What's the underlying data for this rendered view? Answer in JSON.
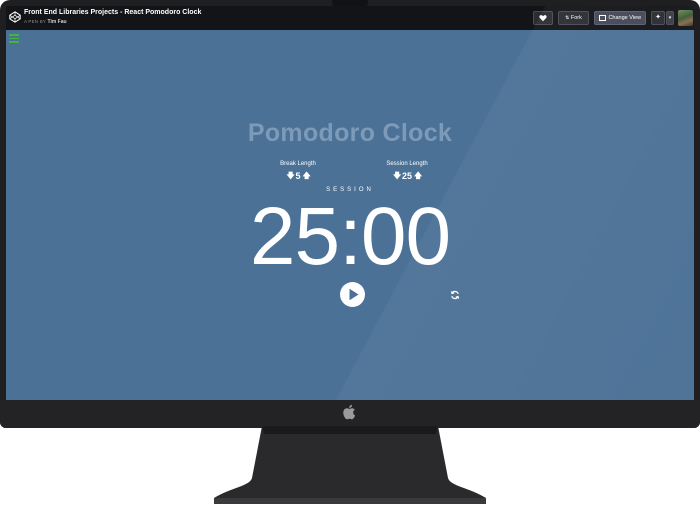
{
  "window": {
    "pen_title": "Front End Libraries Projects - React Pomodoro Clock",
    "pen_prefix": "A PEN BY",
    "author": "Tim Fau"
  },
  "header_buttons": {
    "fork_label": "Fork",
    "change_view_label": "Change View"
  },
  "app": {
    "title": "Pomodoro Clock",
    "break": {
      "label": "Break Length",
      "value": "5"
    },
    "session": {
      "label": "Session Length",
      "value": "25"
    },
    "timer_label": "SESSION",
    "time_left": "25:00"
  },
  "icons": {
    "logo": "codepen-logo-icon",
    "heart": "heart-icon",
    "fork": "fork-icon",
    "view": "change-view-icon",
    "run": "run-icon",
    "menu": "hamburger-menu-icon",
    "play": "play-icon",
    "reset": "refresh-icon",
    "apple": "apple-logo-icon"
  },
  "colors": {
    "screen_bg": "#4b7196",
    "title_text": "#7d9ab8",
    "header_bg": "#131417",
    "menu_accent": "#43b243"
  }
}
